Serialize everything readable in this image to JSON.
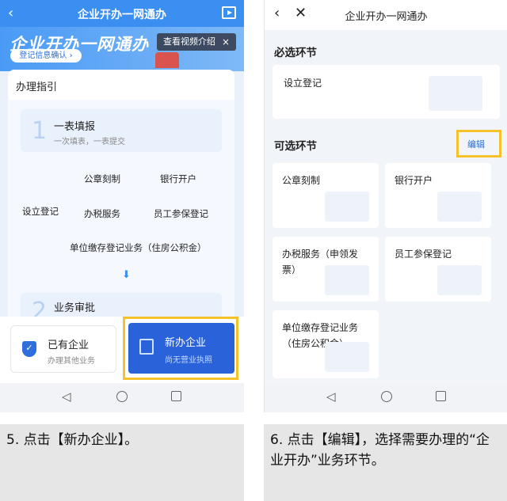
{
  "left": {
    "header_title": "企业开办一网通办",
    "back_icon": "‹",
    "banner_title": "企业开办一网通办",
    "banner_button": "登记信息确认 ›",
    "video_tag": "查看视频介绍",
    "video_close": "×",
    "guide_title": "办理指引",
    "step1": {
      "num": "1",
      "title": "一表填报",
      "sub": "一次填表，一表提交"
    },
    "flow": {
      "setup": "设立登记",
      "seal": "公章刻制",
      "bank": "银行开户",
      "tax": "办税服务",
      "social": "员工参保登记",
      "fund": "单位缴存登记业务（住房公积金）"
    },
    "step2": {
      "num": "2",
      "title": "业务审批"
    },
    "have": {
      "title": "已有企业",
      "sub": "办理其他业务",
      "icon": "✓"
    },
    "new": {
      "title": "新办企业",
      "sub": "尚无营业执照"
    }
  },
  "right": {
    "header_title": "企业开办一网通办",
    "back_icon": "‹",
    "close_icon": "✕",
    "required_label": "必选环节",
    "required_item": "设立登记",
    "optional_label": "可选环节",
    "edit_label": "编辑",
    "items": [
      "公章刻制",
      "银行开户",
      "办税服务（申领发票）",
      "员工参保登记",
      "单位缴存登记业务（住房公积金）"
    ]
  },
  "nav": {
    "back": "◁"
  },
  "captions": {
    "left": "5. 点击【新办企业】。",
    "right": "6. 点击【编辑】，选择需要办理的“企业开办”业务环节。"
  },
  "colors": {
    "accent": "#2a63d9",
    "highlight": "#f5c22b",
    "banner": "#3a8ff0"
  }
}
